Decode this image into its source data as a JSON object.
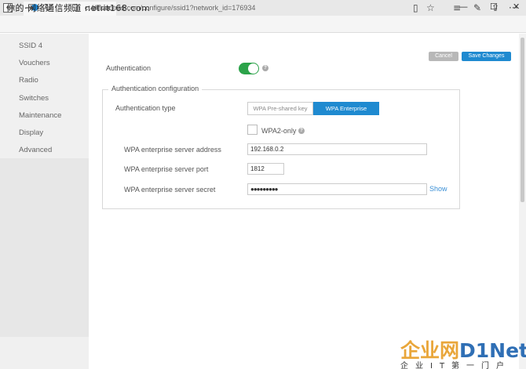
{
  "watermark": "你的·网络通信频道 net.it168.com",
  "tab": {
    "title": "dTrax",
    "new_tab": "+"
  },
  "window": {
    "minimize": "—",
    "maximize": "☐",
    "close": "✕"
  },
  "address": {
    "url": "ct4.cloudtrax.com/configure/ssid1?network_id=176934"
  },
  "nav": {
    "back": "←",
    "forward": "→",
    "refresh": "↻"
  },
  "tools": {
    "reader": "▯",
    "favorite": "☆",
    "hub": "≡",
    "notes": "✎",
    "share": "⇪",
    "more": "···"
  },
  "sidebar": {
    "items": [
      {
        "label": "SSID 4"
      },
      {
        "label": "Vouchers"
      },
      {
        "label": "Radio"
      },
      {
        "label": "Switches"
      },
      {
        "label": "Maintenance"
      },
      {
        "label": "Display"
      },
      {
        "label": "Advanced"
      }
    ]
  },
  "actions": {
    "cancel": "Cancel",
    "save": "Save Changes"
  },
  "auth": {
    "label": "Authentication",
    "enabled": true,
    "help": "?",
    "config_legend": "Authentication configuration",
    "type_label": "Authentication type",
    "type_options": [
      "WPA Pre-shared key",
      "WPA Enterprise"
    ],
    "type_selected": "WPA Enterprise",
    "wpa2_only_label": "WPA2-only",
    "wpa2_only_checked": false,
    "server_address_label": "WPA enterprise server address",
    "server_address_value": "192.168.0.2",
    "server_port_label": "WPA enterprise server port",
    "server_port_value": "1812",
    "server_secret_label": "WPA enterprise server secret",
    "server_secret_value": "●●●●●●●●●",
    "show_link": "Show"
  },
  "logo": {
    "cn": "企业网",
    "d": "D",
    "net": "1Net",
    "sub": "企业IT第一门户"
  },
  "colors": {
    "accent": "#1f8ad0",
    "toggle_on": "#2ca34a",
    "cancel": "#b8b8b8"
  }
}
